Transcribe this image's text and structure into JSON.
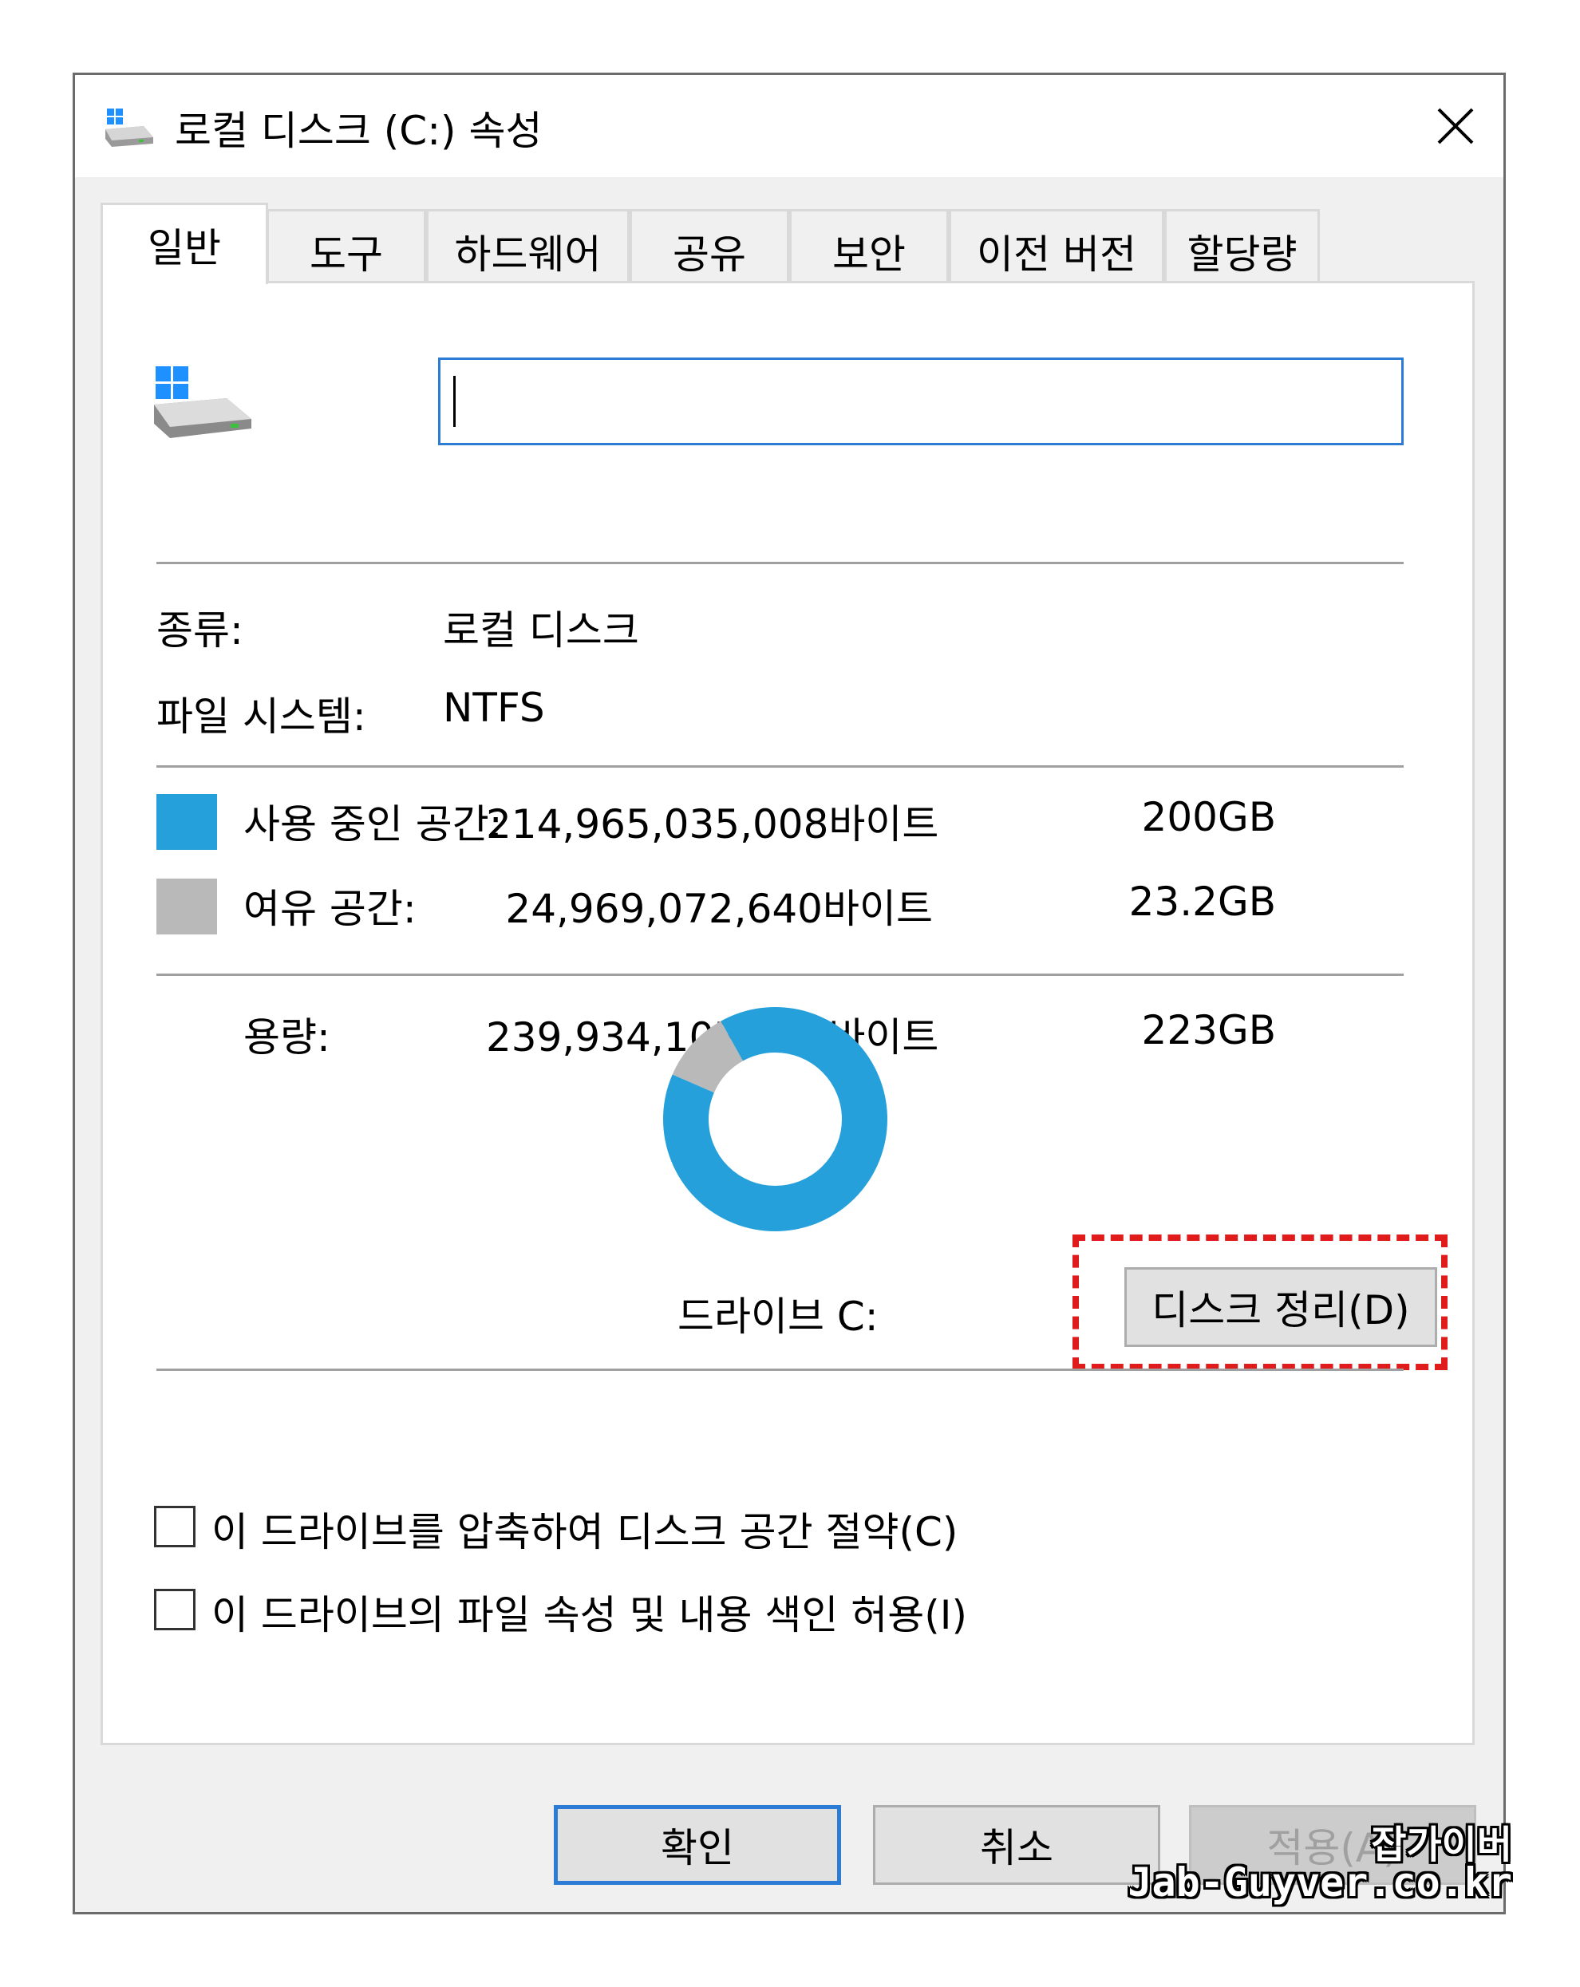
{
  "window": {
    "title": "로컬 디스크 (C:) 속성",
    "icon": "drive-icon",
    "close_icon": "close-icon"
  },
  "tabs": [
    {
      "label": "일반",
      "active": true
    },
    {
      "label": "도구",
      "active": false
    },
    {
      "label": "하드웨어",
      "active": false
    },
    {
      "label": "공유",
      "active": false
    },
    {
      "label": "보안",
      "active": false
    },
    {
      "label": "이전 버전",
      "active": false
    },
    {
      "label": "할당량",
      "active": false
    }
  ],
  "general": {
    "name_input_value": "",
    "type_label": "종류:",
    "type_value": "로컬 디스크",
    "fs_label": "파일 시스템:",
    "fs_value": "NTFS",
    "used": {
      "label": "사용 중인 공간:",
      "bytes": "214,965,035,008바이트",
      "size": "200GB",
      "color": "#26a0da"
    },
    "free": {
      "label": "여유 공간:",
      "bytes": "24,969,072,640바이트",
      "size": "23.2GB",
      "color": "#b9b9b9"
    },
    "capacity": {
      "label": "용량:",
      "bytes": "239,934,107,648바이트",
      "size": "223GB"
    },
    "drive_label": "드라이브 C:",
    "cleanup_button": "디스크 정리(D)",
    "compress_checkbox": {
      "label": "이 드라이브를 압축하여 디스크 공간 절약(C)",
      "checked": false
    },
    "index_checkbox": {
      "label": "이 드라이브의 파일 속성 및 내용 색인 허용(I)",
      "checked": false
    }
  },
  "chart_data": {
    "type": "pie",
    "categories": [
      "사용 중인 공간",
      "여유 공간"
    ],
    "values": [
      214965035008,
      24969072640
    ],
    "colors": [
      "#26a0da",
      "#b9b9b9"
    ]
  },
  "buttons": {
    "ok": "확인",
    "cancel": "취소",
    "apply": "적용(A)"
  },
  "watermark": {
    "line1": "잡가이버",
    "line2": "Jab-Guyver.co.kr"
  }
}
